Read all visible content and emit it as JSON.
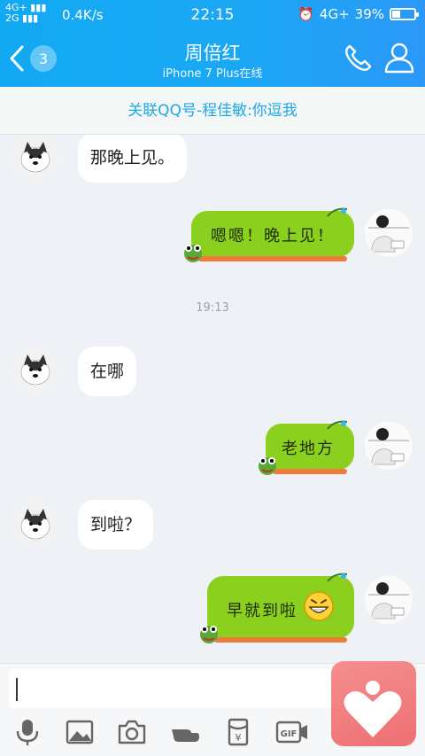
{
  "status_bar": {
    "network_top": "4G+",
    "network_bottom": "2G",
    "speed": "0.4K/s",
    "time": "22:15",
    "network_right": "4G+",
    "battery": "39%",
    "battery_level": 0.39
  },
  "header": {
    "unread_count": "3",
    "contact_name": "周倍红",
    "contact_status": "iPhone 7 Plus在线"
  },
  "link_banner": "关联QQ号-程佳敏:你逗我",
  "messages": [
    {
      "side": "in",
      "text": "那晚上见。"
    },
    {
      "side": "out",
      "text": "嗯嗯！晚上见！"
    },
    {
      "type": "time",
      "text": "19:13"
    },
    {
      "side": "in",
      "text": "在哪"
    },
    {
      "side": "out",
      "text": "老地方"
    },
    {
      "side": "in",
      "text": "到啦？"
    },
    {
      "side": "out",
      "text": "早就到啦"
    }
  ],
  "input": {
    "value": ""
  },
  "toolbar": [
    "mic-icon",
    "image-icon",
    "camera-icon",
    "shake-icon",
    "red-packet-icon",
    "gif-icon"
  ],
  "colors": {
    "header": "#1aa8f5",
    "link_text": "#1ea6e8",
    "bubble_out": "#8cd01f",
    "bubble_trim": "#f07a3a"
  }
}
